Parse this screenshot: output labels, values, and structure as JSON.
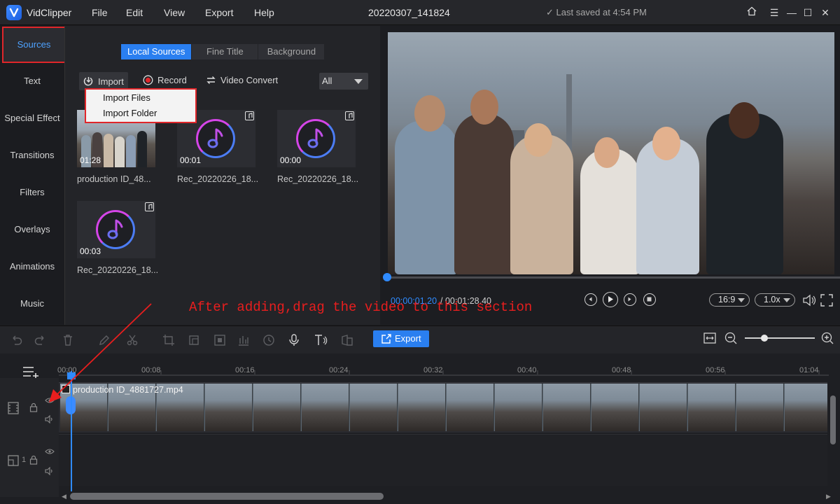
{
  "app": {
    "name": "VidClipper",
    "menus": [
      "File",
      "Edit",
      "View",
      "Export",
      "Help"
    ],
    "document_title": "20220307_141824",
    "save_status": "✓ Last saved at 4:54 PM"
  },
  "sidebar": {
    "items": [
      "Sources",
      "Text",
      "Special Effect",
      "Transitions",
      "Filters",
      "Overlays",
      "Animations",
      "Music"
    ],
    "active": "Sources"
  },
  "source_panel": {
    "tabs": [
      "Local Sources",
      "Fine Title",
      "Background"
    ],
    "active_tab": "Local Sources",
    "tools": {
      "import": "Import",
      "record": "Record",
      "convert": "Video Convert"
    },
    "filter_value": "All",
    "import_menu": [
      "Import Files",
      "Import Folder"
    ],
    "media": [
      {
        "name": "production ID_48...",
        "duration": "01:28",
        "kind": "video"
      },
      {
        "name": "Rec_20220226_18...",
        "duration": "00:01",
        "kind": "audio"
      },
      {
        "name": "Rec_20220226_18...",
        "duration": "00:00",
        "kind": "audio"
      },
      {
        "name": "Rec_20220226_18...",
        "duration": "00:03",
        "kind": "audio"
      }
    ]
  },
  "preview": {
    "current_time": "00:00:01.20",
    "total_time": "/ 00:01:28.40",
    "aspect": "16:9",
    "speed": "1.0x",
    "progress": 0.01
  },
  "annotation": "After adding,drag the video to this section",
  "timeline": {
    "export_label": "Export",
    "ruler_ticks": [
      "00:00",
      "00:08",
      "00:16",
      "00:24",
      "00:32",
      "00:40",
      "00:48",
      "00:56",
      "01:04"
    ],
    "clip_name": "production ID_4881727.mp4",
    "track2_number": "1",
    "zoom": 0.3
  },
  "colors": {
    "accent": "#2a7ff0",
    "highlight": "#e0262a",
    "annotation": "#e81e1e"
  }
}
